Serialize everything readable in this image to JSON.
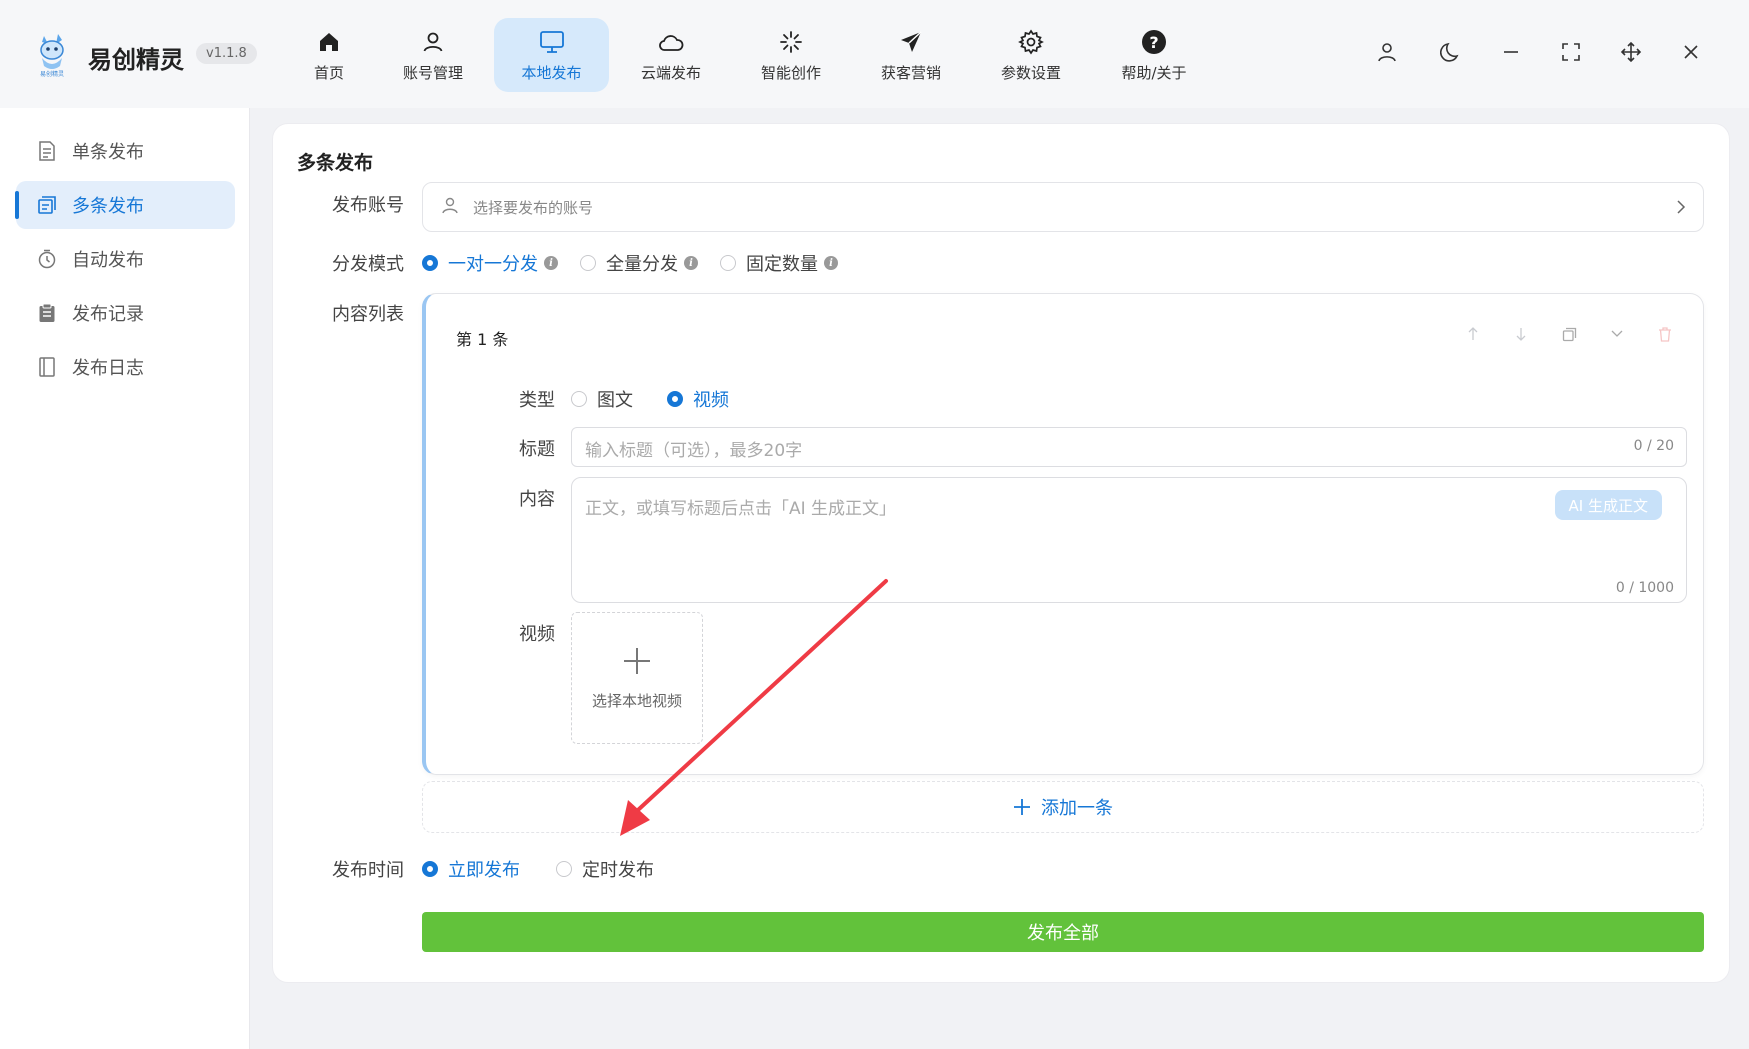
{
  "app": {
    "name": "易创精灵",
    "version": "v1.1.8",
    "logo_caption": "易创精灵"
  },
  "nav": [
    {
      "label": "首页",
      "icon": "home-icon"
    },
    {
      "label": "账号管理",
      "icon": "user-icon"
    },
    {
      "label": "本地发布",
      "icon": "monitor-icon",
      "active": true
    },
    {
      "label": "云端发布",
      "icon": "cloud-icon"
    },
    {
      "label": "智能创作",
      "icon": "sparkle-icon"
    },
    {
      "label": "获客营销",
      "icon": "send-icon"
    },
    {
      "label": "参数设置",
      "icon": "gear-icon"
    },
    {
      "label": "帮助/关于",
      "icon": "help-icon"
    }
  ],
  "window_controls": [
    "user-icon",
    "moon-icon",
    "minimize-icon",
    "fullscreen-icon",
    "move-icon",
    "close-icon"
  ],
  "sidebar": {
    "items": [
      {
        "label": "单条发布",
        "icon": "document-icon"
      },
      {
        "label": "多条发布",
        "icon": "multi-document-icon",
        "active": true
      },
      {
        "label": "自动发布",
        "icon": "timer-icon"
      },
      {
        "label": "发布记录",
        "icon": "clipboard-icon"
      },
      {
        "label": "发布日志",
        "icon": "notebook-icon"
      }
    ]
  },
  "form": {
    "title": "多条发布",
    "account_label": "发布账号",
    "account_placeholder": "选择要发布的账号",
    "mode_label": "分发模式",
    "modes": [
      {
        "label": "一对一分发",
        "selected": true
      },
      {
        "label": "全量分发",
        "selected": false
      },
      {
        "label": "固定数量",
        "selected": false
      }
    ],
    "content_list_label": "内容列表",
    "item": {
      "title": "第 1 条",
      "type_label": "类型",
      "types": [
        {
          "label": "图文",
          "selected": false
        },
        {
          "label": "视频",
          "selected": true
        }
      ],
      "title_label": "标题",
      "title_placeholder": "输入标题（可选），最多20字",
      "title_counter": "0 / 20",
      "content_label": "内容",
      "content_placeholder": "正文，或填写标题后点击「AI 生成正文」",
      "ai_button": "AI 生成正文",
      "content_counter": "0 / 1000",
      "video_label": "视频",
      "video_upload": "选择本地视频"
    },
    "add_label": "添加一条",
    "time_label": "发布时间",
    "time_options": [
      {
        "label": "立即发布",
        "selected": true
      },
      {
        "label": "定时发布",
        "selected": false
      }
    ],
    "publish_button": "发布全部"
  },
  "colors": {
    "accent": "#1677d6",
    "publish": "#62c23b",
    "annotation_arrow": "#ef3b45"
  }
}
